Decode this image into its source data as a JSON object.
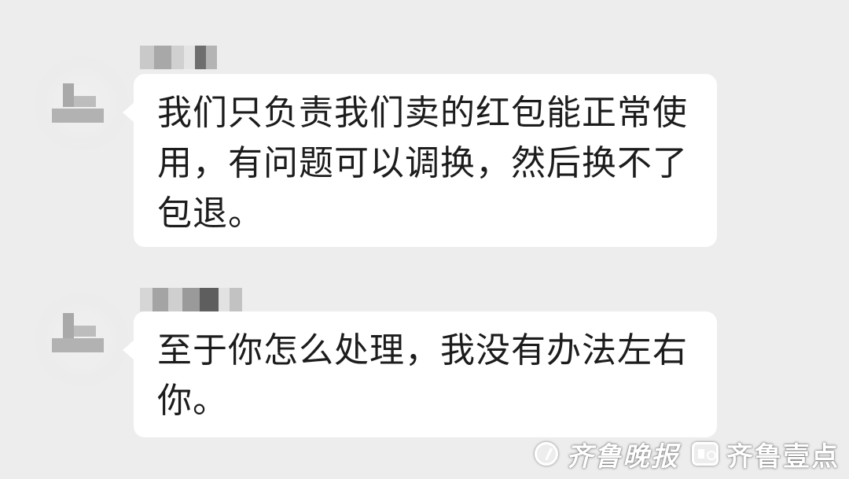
{
  "messages": [
    {
      "sender": "",
      "text": "我们只负责我们卖的红包能正常使用，有问题可以调换，然后换不了包退。"
    },
    {
      "sender": "",
      "text": "至于你怎么处理，我没有办法左右你。"
    }
  ],
  "colors": {
    "background": "#ededed",
    "bubble": "#ffffff",
    "text": "#1c1c1c",
    "mosaic": "#a9a9a9"
  },
  "watermark": {
    "newspaper": "齐鲁晚报",
    "app": "齐鲁壹点",
    "newspaper_icon": "circle-slash-icon",
    "app_icon": "app-logo-icon"
  }
}
